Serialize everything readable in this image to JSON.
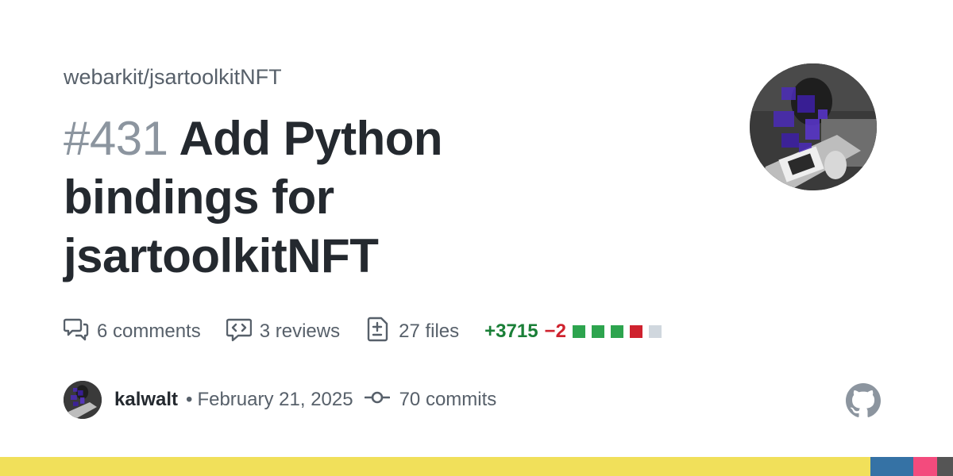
{
  "repo": "webarkit/jsartoolkitNFT",
  "pr": {
    "number": "#431",
    "title": "Add Python bindings for jsartoolkitNFT"
  },
  "stats": {
    "comments": "6 comments",
    "reviews": "3 reviews",
    "files": "27 files",
    "additions": "+3715",
    "deletions": "−2",
    "diff_squares": [
      "#2da44e",
      "#2da44e",
      "#2da44e",
      "#cf222e",
      "#d0d7de"
    ]
  },
  "author": {
    "name": "kalwalt",
    "separator": "•",
    "date": "February 21, 2025",
    "commits": "70 commits"
  },
  "icons": {
    "comments": "comment-discussion-icon",
    "reviews": "code-review-icon",
    "files": "file-diff-icon",
    "commits": "git-commit-icon",
    "logo": "github-mark-icon"
  },
  "colors": {
    "additions": "#1a7f37",
    "deletions": "#cf222e",
    "footer": [
      "#f1e05a",
      "#3572a5",
      "#f34b7d",
      "#555555"
    ]
  }
}
